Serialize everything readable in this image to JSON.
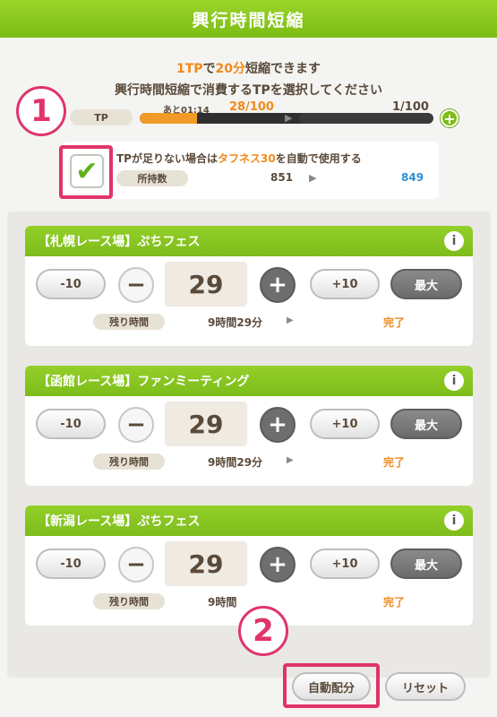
{
  "header": {
    "title": "興行時間短縮"
  },
  "message": {
    "line1_a": "1TP",
    "line1_b": "で",
    "line1_c": "20分",
    "line1_d": "短縮できます",
    "line2": "興行時間短縮で消費するTPを選択してください"
  },
  "tp": {
    "label": "TP",
    "time_left": "あと01:14",
    "current": "28/100",
    "after": "1/100",
    "fill_fraction": 0.28
  },
  "auto_use": {
    "checked": true,
    "text_a": "TPが足りない場合は",
    "text_b": "タフネス30",
    "text_c": "を自動で使用する",
    "owned_label": "所持数",
    "owned_current": "851",
    "owned_after": "849"
  },
  "annotations": {
    "step1": "1",
    "step2": "2"
  },
  "cards": [
    {
      "title": "【札幌レース場】ぷちフェス",
      "minus10": "-10",
      "value": "29",
      "plus10": "+10",
      "max": "最大",
      "remain_label": "残り時間",
      "remain_value": "9時間29分",
      "status": "完了"
    },
    {
      "title": "【函館レース場】ファンミーティング",
      "minus10": "-10",
      "value": "29",
      "plus10": "+10",
      "max": "最大",
      "remain_label": "残り時間",
      "remain_value": "9時間29分",
      "status": "完了"
    },
    {
      "title": "【新潟レース場】ぷちフェス",
      "minus10": "-10",
      "value": "29",
      "plus10": "+10",
      "max": "最大",
      "remain_label": "残り時間",
      "remain_value": "9時間",
      "status": "完了"
    }
  ],
  "footer": {
    "auto_label": "自動配分",
    "reset_label": "リセット"
  },
  "colors": {
    "accent": "#7cbd16",
    "highlight": "#e0346a",
    "orange": "#f08a1c",
    "blue": "#2f8fd6"
  }
}
